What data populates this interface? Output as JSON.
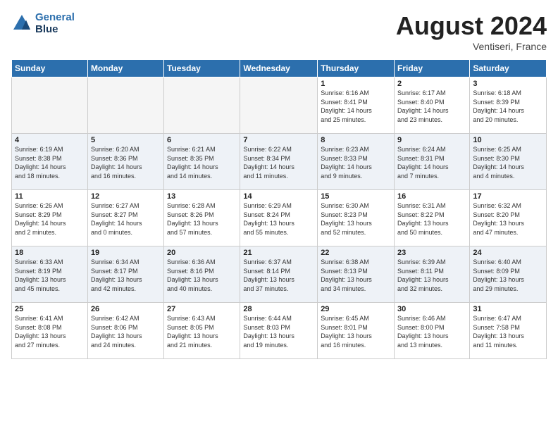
{
  "header": {
    "logo_line1": "General",
    "logo_line2": "Blue",
    "month_title": "August 2024",
    "subtitle": "Ventiseri, France"
  },
  "weekdays": [
    "Sunday",
    "Monday",
    "Tuesday",
    "Wednesday",
    "Thursday",
    "Friday",
    "Saturday"
  ],
  "weeks": [
    [
      {
        "day": "",
        "info": ""
      },
      {
        "day": "",
        "info": ""
      },
      {
        "day": "",
        "info": ""
      },
      {
        "day": "",
        "info": ""
      },
      {
        "day": "1",
        "info": "Sunrise: 6:16 AM\nSunset: 8:41 PM\nDaylight: 14 hours\nand 25 minutes."
      },
      {
        "day": "2",
        "info": "Sunrise: 6:17 AM\nSunset: 8:40 PM\nDaylight: 14 hours\nand 23 minutes."
      },
      {
        "day": "3",
        "info": "Sunrise: 6:18 AM\nSunset: 8:39 PM\nDaylight: 14 hours\nand 20 minutes."
      }
    ],
    [
      {
        "day": "4",
        "info": "Sunrise: 6:19 AM\nSunset: 8:38 PM\nDaylight: 14 hours\nand 18 minutes."
      },
      {
        "day": "5",
        "info": "Sunrise: 6:20 AM\nSunset: 8:36 PM\nDaylight: 14 hours\nand 16 minutes."
      },
      {
        "day": "6",
        "info": "Sunrise: 6:21 AM\nSunset: 8:35 PM\nDaylight: 14 hours\nand 14 minutes."
      },
      {
        "day": "7",
        "info": "Sunrise: 6:22 AM\nSunset: 8:34 PM\nDaylight: 14 hours\nand 11 minutes."
      },
      {
        "day": "8",
        "info": "Sunrise: 6:23 AM\nSunset: 8:33 PM\nDaylight: 14 hours\nand 9 minutes."
      },
      {
        "day": "9",
        "info": "Sunrise: 6:24 AM\nSunset: 8:31 PM\nDaylight: 14 hours\nand 7 minutes."
      },
      {
        "day": "10",
        "info": "Sunrise: 6:25 AM\nSunset: 8:30 PM\nDaylight: 14 hours\nand 4 minutes."
      }
    ],
    [
      {
        "day": "11",
        "info": "Sunrise: 6:26 AM\nSunset: 8:29 PM\nDaylight: 14 hours\nand 2 minutes."
      },
      {
        "day": "12",
        "info": "Sunrise: 6:27 AM\nSunset: 8:27 PM\nDaylight: 14 hours\nand 0 minutes."
      },
      {
        "day": "13",
        "info": "Sunrise: 6:28 AM\nSunset: 8:26 PM\nDaylight: 13 hours\nand 57 minutes."
      },
      {
        "day": "14",
        "info": "Sunrise: 6:29 AM\nSunset: 8:24 PM\nDaylight: 13 hours\nand 55 minutes."
      },
      {
        "day": "15",
        "info": "Sunrise: 6:30 AM\nSunset: 8:23 PM\nDaylight: 13 hours\nand 52 minutes."
      },
      {
        "day": "16",
        "info": "Sunrise: 6:31 AM\nSunset: 8:22 PM\nDaylight: 13 hours\nand 50 minutes."
      },
      {
        "day": "17",
        "info": "Sunrise: 6:32 AM\nSunset: 8:20 PM\nDaylight: 13 hours\nand 47 minutes."
      }
    ],
    [
      {
        "day": "18",
        "info": "Sunrise: 6:33 AM\nSunset: 8:19 PM\nDaylight: 13 hours\nand 45 minutes."
      },
      {
        "day": "19",
        "info": "Sunrise: 6:34 AM\nSunset: 8:17 PM\nDaylight: 13 hours\nand 42 minutes."
      },
      {
        "day": "20",
        "info": "Sunrise: 6:36 AM\nSunset: 8:16 PM\nDaylight: 13 hours\nand 40 minutes."
      },
      {
        "day": "21",
        "info": "Sunrise: 6:37 AM\nSunset: 8:14 PM\nDaylight: 13 hours\nand 37 minutes."
      },
      {
        "day": "22",
        "info": "Sunrise: 6:38 AM\nSunset: 8:13 PM\nDaylight: 13 hours\nand 34 minutes."
      },
      {
        "day": "23",
        "info": "Sunrise: 6:39 AM\nSunset: 8:11 PM\nDaylight: 13 hours\nand 32 minutes."
      },
      {
        "day": "24",
        "info": "Sunrise: 6:40 AM\nSunset: 8:09 PM\nDaylight: 13 hours\nand 29 minutes."
      }
    ],
    [
      {
        "day": "25",
        "info": "Sunrise: 6:41 AM\nSunset: 8:08 PM\nDaylight: 13 hours\nand 27 minutes."
      },
      {
        "day": "26",
        "info": "Sunrise: 6:42 AM\nSunset: 8:06 PM\nDaylight: 13 hours\nand 24 minutes."
      },
      {
        "day": "27",
        "info": "Sunrise: 6:43 AM\nSunset: 8:05 PM\nDaylight: 13 hours\nand 21 minutes."
      },
      {
        "day": "28",
        "info": "Sunrise: 6:44 AM\nSunset: 8:03 PM\nDaylight: 13 hours\nand 19 minutes."
      },
      {
        "day": "29",
        "info": "Sunrise: 6:45 AM\nSunset: 8:01 PM\nDaylight: 13 hours\nand 16 minutes."
      },
      {
        "day": "30",
        "info": "Sunrise: 6:46 AM\nSunset: 8:00 PM\nDaylight: 13 hours\nand 13 minutes."
      },
      {
        "day": "31",
        "info": "Sunrise: 6:47 AM\nSunset: 7:58 PM\nDaylight: 13 hours\nand 11 minutes."
      }
    ]
  ]
}
